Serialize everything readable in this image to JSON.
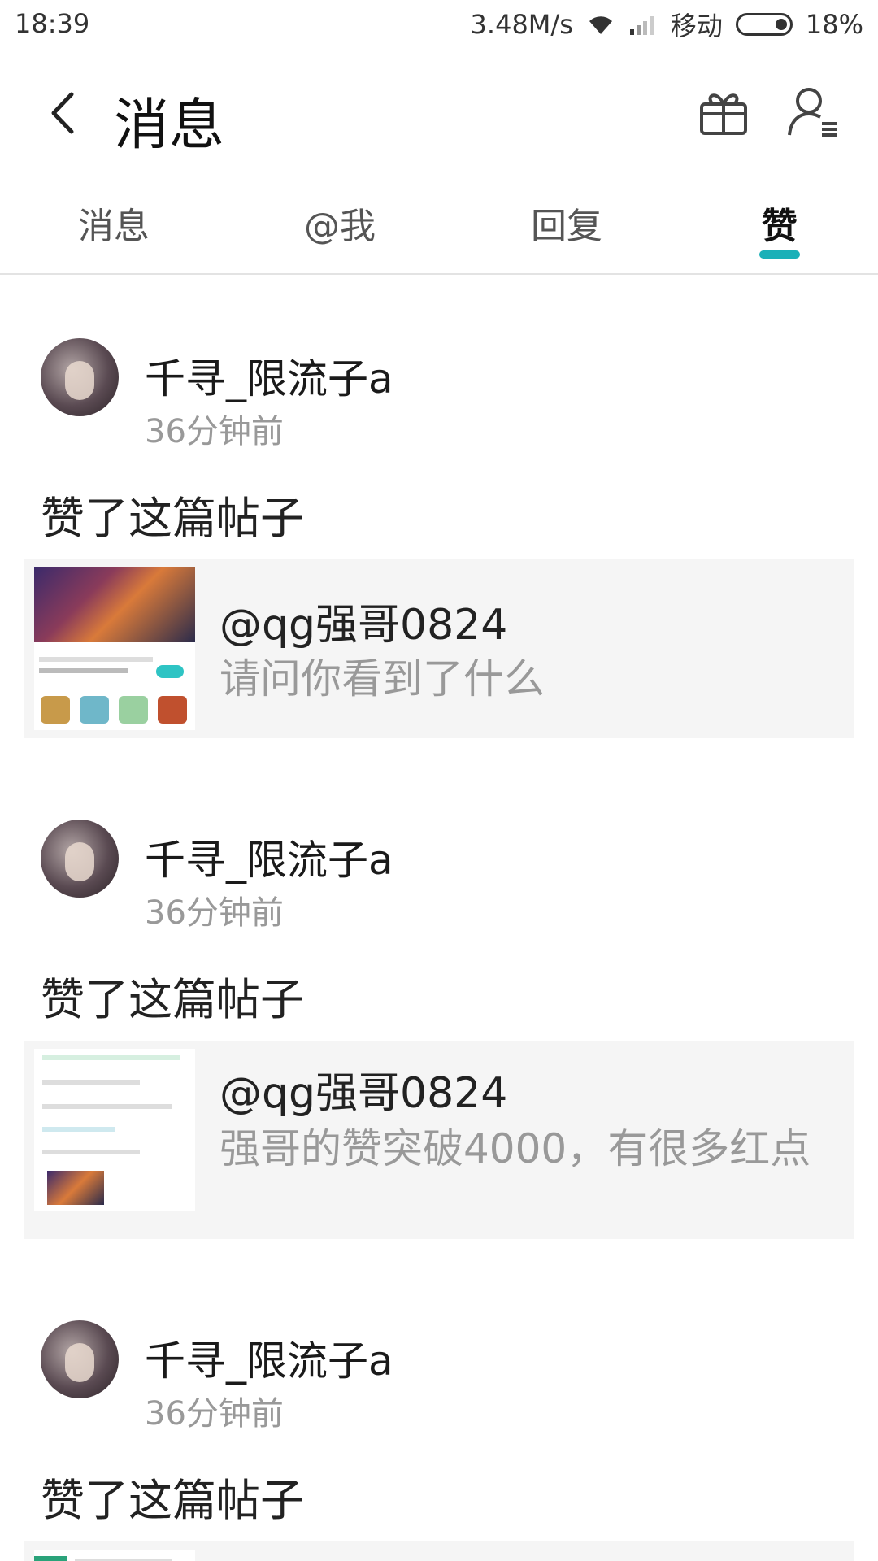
{
  "status_bar": {
    "time": "18:39",
    "speed": "3.48M/s",
    "carrier": "移动",
    "battery": "18%"
  },
  "header": {
    "title": "消息"
  },
  "tabs": [
    {
      "label": "消息",
      "active": false
    },
    {
      "label": "@我",
      "active": false
    },
    {
      "label": "回复",
      "active": false
    },
    {
      "label": "赞",
      "active": true
    }
  ],
  "accent_color": "#1ab0b8",
  "items": [
    {
      "username": "千寻_限流子a",
      "time": "36分钟前",
      "action": "赞了这篇帖子",
      "post_user": "@qg强哥0824",
      "post_text": "请问你看到了什么"
    },
    {
      "username": "千寻_限流子a",
      "time": "36分钟前",
      "action": "赞了这篇帖子",
      "post_user": "@qg强哥0824",
      "post_text": "强哥的赞突破4000，有很多红点"
    },
    {
      "username": "千寻_限流子a",
      "time": "36分钟前",
      "action": "赞了这篇帖子"
    }
  ]
}
